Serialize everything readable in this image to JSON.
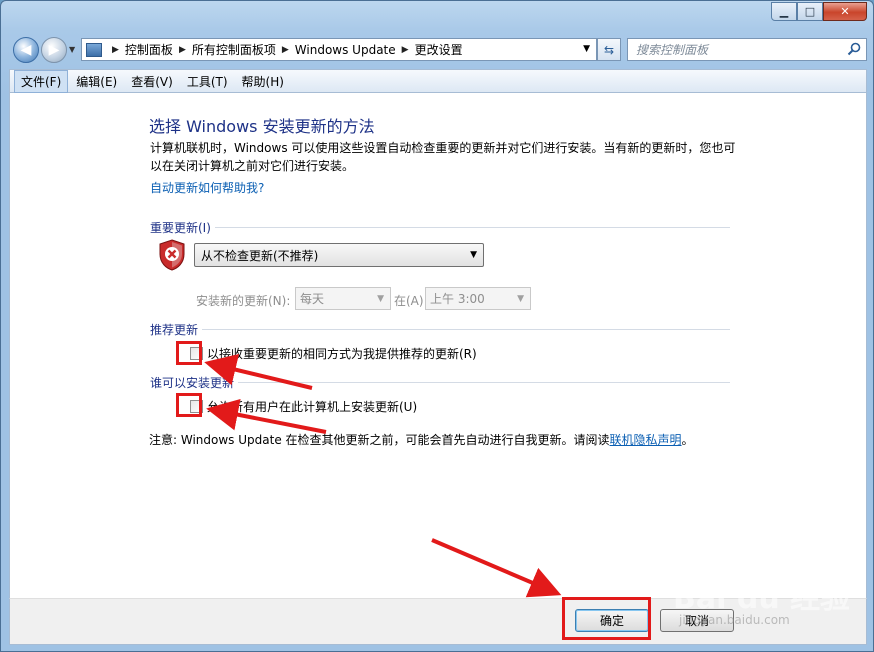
{
  "window": {
    "caption": {
      "minimize": "▁",
      "maximize": "□",
      "close": "✕"
    }
  },
  "nav": {
    "breadcrumbs": [
      "控制面板",
      "所有控制面板项",
      "Windows Update",
      "更改设置"
    ],
    "search_placeholder": "搜索控制面板"
  },
  "menu": [
    "文件(F)",
    "编辑(E)",
    "查看(V)",
    "工具(T)",
    "帮助(H)"
  ],
  "main": {
    "title": "选择 Windows 安装更新的方法",
    "description": "计算机联机时，Windows 可以使用这些设置自动检查重要的更新并对它们进行安装。当有新的更新时，您也可以在关闭计算机之前对它们进行安装。",
    "help_link": "自动更新如何帮助我?",
    "important_updates": {
      "label": "重要更新(I)",
      "selected": "从不检查更新(不推荐)",
      "install_label": "安装新的更新(N):",
      "day_value": "每天",
      "at_label": "在(A)",
      "time_value": "上午 3:00"
    },
    "recommended_updates": {
      "label": "推荐更新",
      "checkbox_label": "以接收重要更新的相同方式为我提供推荐的更新(R)",
      "checked": false
    },
    "who_can_install": {
      "label": "谁可以安装更新",
      "checkbox_label": "允许所有用户在此计算机上安装更新(U)",
      "checked": false
    },
    "note_prefix": "注意: Windows Update 在检查其他更新之前，可能会首先自动进行自我更新。请阅读",
    "note_link": "联机隐私声明",
    "note_suffix": "。"
  },
  "footer": {
    "ok_label": "确定",
    "cancel_label": "取消"
  },
  "colors": {
    "annotation_red": "#e21a1a",
    "title_blue": "#1e3287",
    "link_blue": "#0b5fb3"
  },
  "watermark": {
    "text": "Bai du 经验",
    "sub": "jingyan.baidu.com"
  }
}
